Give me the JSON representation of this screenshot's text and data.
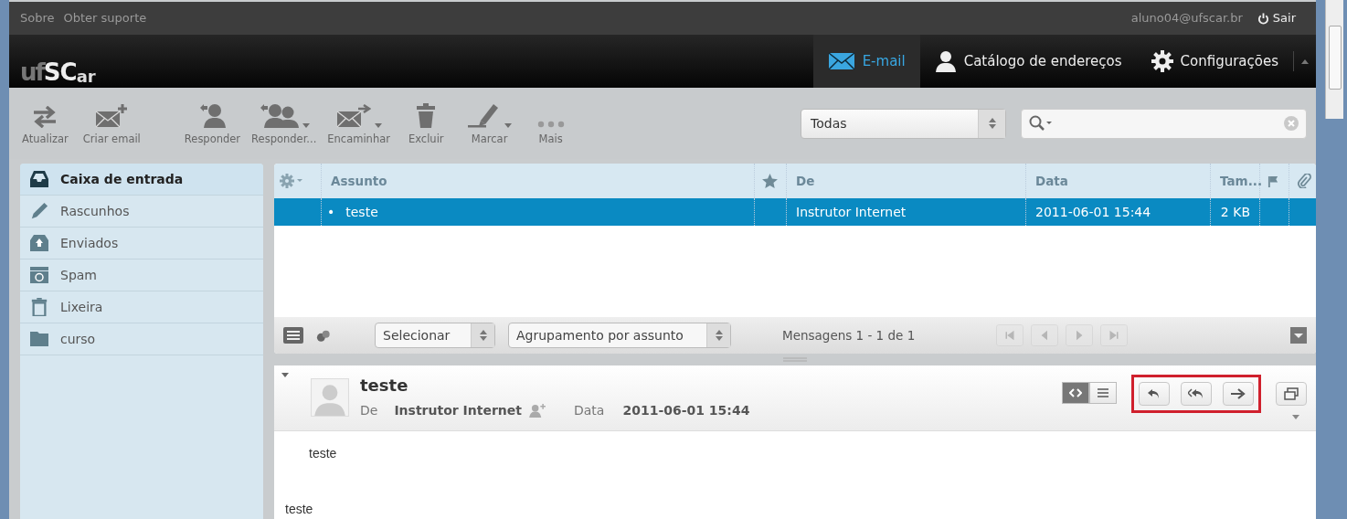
{
  "top_bar": {
    "links": [
      "Sobre",
      "Obter suporte"
    ],
    "user": "aluno04@ufscar.br",
    "logout": "Sair"
  },
  "logo": {
    "left": "uf",
    "main": "SC",
    "suffix": "ar"
  },
  "nav_tabs": [
    {
      "label": "E-mail",
      "selected": true
    },
    {
      "label": "Catálogo de endereços",
      "selected": false
    },
    {
      "label": "Configurações",
      "selected": false
    }
  ],
  "toolbar": {
    "buttons": [
      {
        "label": "Atualizar",
        "dropdown": false
      },
      {
        "label": "Criar email",
        "dropdown": false
      },
      {
        "label": "Responder",
        "dropdown": false
      },
      {
        "label": "Responder...",
        "dropdown": true
      },
      {
        "label": "Encaminhar",
        "dropdown": true
      },
      {
        "label": "Excluir",
        "dropdown": false
      },
      {
        "label": "Marcar",
        "dropdown": true
      },
      {
        "label": "Mais",
        "dropdown": false
      }
    ],
    "filter": "Todas"
  },
  "folders": [
    {
      "label": "Caixa de entrada",
      "selected": true
    },
    {
      "label": "Rascunhos",
      "selected": false
    },
    {
      "label": "Enviados",
      "selected": false
    },
    {
      "label": "Spam",
      "selected": false
    },
    {
      "label": "Lixeira",
      "selected": false
    },
    {
      "label": "curso",
      "selected": false
    }
  ],
  "message_list": {
    "columns": [
      "Assunto",
      "De",
      "Data",
      "Tam..."
    ],
    "rows": [
      {
        "bullet": "•",
        "subject": "teste",
        "from": "Instrutor Internet",
        "date": "2011-06-01 15:44",
        "size": "2 KB",
        "selected": true
      }
    ],
    "footer": {
      "select": "Selecionar",
      "grouping": "Agrupamento por assunto",
      "count": "Mensagens 1 - 1 de 1",
      "pager": [
        {
          "disabled": true
        },
        {
          "disabled": true
        },
        {
          "disabled": true
        },
        {
          "disabled": true
        }
      ]
    }
  },
  "preview": {
    "subject": "teste",
    "from_label": "De",
    "from": "Instrutor Internet",
    "date_label": "Data",
    "date": "2011-06-01 15:44",
    "view_toggle": [
      {
        "selected": true
      },
      {
        "selected": false
      }
    ],
    "body": [
      "teste",
      "teste"
    ]
  }
}
